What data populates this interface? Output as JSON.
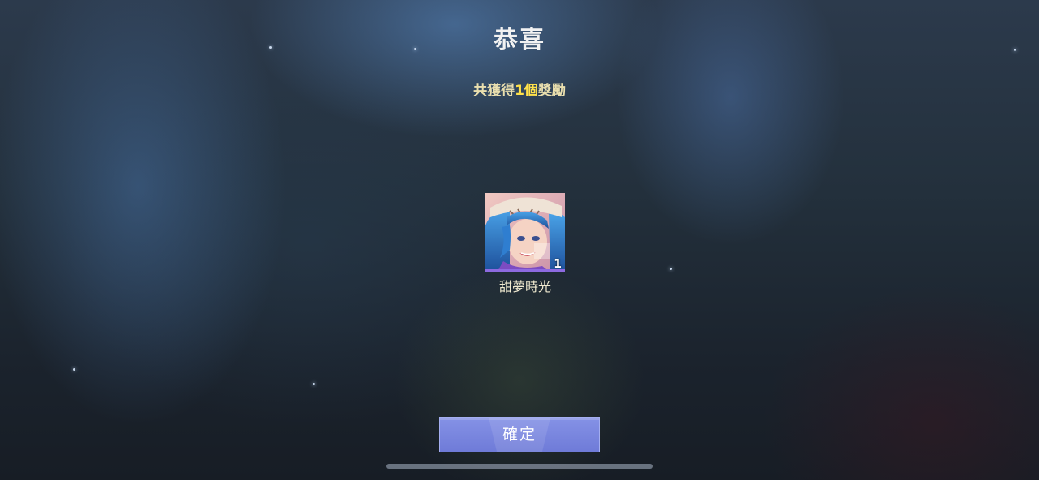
{
  "dialog": {
    "title": "恭喜",
    "subtitle_prefix": "共獲得",
    "subtitle_count": "1個",
    "subtitle_suffix": "獎勵"
  },
  "reward": {
    "name": "甜夢時光",
    "quantity": "1",
    "icon": "hero-skin-portrait-icon"
  },
  "actions": {
    "confirm_label": "確定"
  },
  "colors": {
    "accent_count": "#ffe14a",
    "button": "#7c88e0",
    "title": "#f2f2f2"
  }
}
